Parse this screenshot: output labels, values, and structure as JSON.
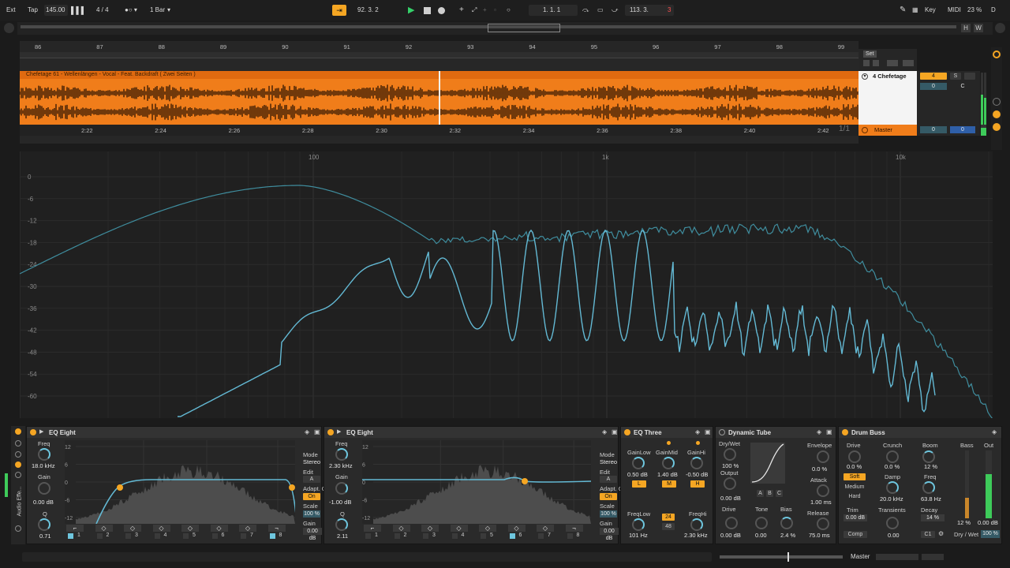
{
  "transport": {
    "ext": "Ext",
    "tap": "Tap",
    "tempo": "145.00",
    "signature": "4 / 4",
    "quantize": "1 Bar",
    "position": "92.  3.  2",
    "loop_start": "1.  1.  1",
    "loop_length": "113.  3.",
    "loop_length_accent": "3",
    "key": "Key",
    "midi": "MIDI",
    "cpu": "23 %",
    "d": "D"
  },
  "overview": {
    "h": "H",
    "w": "W"
  },
  "arrangement": {
    "bars": [
      "86",
      "87",
      "88",
      "89",
      "90",
      "91",
      "92",
      "93",
      "94",
      "95",
      "96",
      "97",
      "98",
      "99"
    ],
    "times": [
      "2:22",
      "2:24",
      "2:26",
      "2:28",
      "2:30",
      "2:32",
      "2:34",
      "2:36",
      "2:38",
      "2:40",
      "2:42"
    ],
    "clip_title": "Chefetage 61 - Wellenlängen  - Vocal        - Feat. Backdraft ( Zwei Seiten )",
    "set_label": "Set",
    "track_name": "4 Chefetage",
    "track_number": "4",
    "track_s": "S",
    "track_zero": "0",
    "track_c": "C",
    "master_label": "Master",
    "master_zero1": "0",
    "master_zero2": "0",
    "fraction": "1/1"
  },
  "spectrum": {
    "freq_labels": [
      "100",
      "1k",
      "10k"
    ],
    "db_labels": [
      "0",
      "-6",
      "-12",
      "-18",
      "-24",
      "-30",
      "-36",
      "-42",
      "-48",
      "-54",
      "-60"
    ],
    "line_color": "#63b9d4",
    "dim_line_color": "#3f8d9e"
  },
  "eq1": {
    "title": "EQ Eight",
    "freq_label": "Freq",
    "freq_val": "18.0 kHz",
    "gain_label": "Gain",
    "gain_val": "0.00 dB",
    "q_label": "Q",
    "q_val": "0.71",
    "db_scale": [
      "12",
      "6",
      "0",
      "-6",
      "-12"
    ],
    "freq_scale": [
      "100",
      "1k",
      "10k"
    ],
    "mode_label": "Mode",
    "mode_val": "Stereo",
    "edit": "Edit",
    "edit_a": "A",
    "adapt_label": "Adapt. Q",
    "adapt_val": "On",
    "scale_label": "Scale",
    "scale_val": "100 %",
    "gain2_label": "Gain",
    "gain2_val": "0.00 dB",
    "bands": [
      "1",
      "2",
      "3",
      "4",
      "5",
      "6",
      "7",
      "8"
    ],
    "side_label": "Audio Effe..."
  },
  "eq2": {
    "title": "EQ Eight",
    "freq_label": "Freq",
    "freq_val": "2.30 kHz",
    "gain_label": "Gain",
    "gain_val": "-1.00 dB",
    "q_label": "Q",
    "q_val": "2.11",
    "db_scale": [
      "12",
      "6",
      "0",
      "-6",
      "-12"
    ],
    "freq_scale": [
      "100",
      "1k",
      "10k"
    ],
    "mode_label": "Mode",
    "mode_val": "Stereo",
    "edit": "Edit",
    "edit_a": "A",
    "adapt_label": "Adapt. Q",
    "adapt_val": "On",
    "scale_label": "Scale",
    "scale_val": "100 %",
    "gain2_label": "Gain",
    "gain2_val": "0.00 dB",
    "bands": [
      "1",
      "2",
      "3",
      "4",
      "5",
      "6",
      "7",
      "8"
    ]
  },
  "eq3": {
    "title": "EQ Three",
    "gainlow_label": "GainLow",
    "gainmid_label": "GainMid",
    "gainhi_label": "GainHi",
    "gainlow_val": "0.50 dB",
    "gainmid_val": "1.40 dB",
    "gainhi_val": "-0.50 dB",
    "l": "L",
    "m": "M",
    "h": "H",
    "freqlow_label": "FreqLow",
    "freqhi_label": "FreqHi",
    "freqlow_val": "101 Hz",
    "freqhi_val": "2.30 kHz",
    "slope_24": "24",
    "slope_48": "48"
  },
  "tube": {
    "title": "Dynamic Tube",
    "drywet_label": "Dry/Wet",
    "drywet_val": "100 %",
    "output_label": "Output",
    "output_val": "0.00 dB",
    "envelope_label": "Envelope",
    "envelope_val": "0.0 %",
    "attack_label": "Attack",
    "attack_val": "1.00 ms",
    "release_label": "Release",
    "release_val": "75.0 ms",
    "drive_label": "Drive",
    "tone_label": "Tone",
    "bias_label": "Bias",
    "drive_val": "0.00 dB",
    "tone_val": "0.00",
    "bias_val": "2.4 %",
    "abc": [
      "A",
      "B",
      "C"
    ]
  },
  "drumbuss": {
    "title": "Drum Buss",
    "drive_label": "Drive",
    "drive_val": "0.0 %",
    "crunch_label": "Crunch",
    "crunch_val": "0.0 %",
    "boom_label": "Boom",
    "boom_val": "12 %",
    "soft": "Soft",
    "medium": "Medium",
    "hard": "Hard",
    "damp_label": "Damp",
    "damp_val": "20.0 kHz",
    "freq_label": "Freq",
    "freq_val": "63.8 Hz",
    "trim_label": "Trim",
    "trim_val": "0.00 dB",
    "transients_label": "Transients",
    "transients_val": "0.00",
    "decay_label": "Decay",
    "decay_val": "14 %",
    "comp": "Comp",
    "bass_label": "Bass",
    "out_label": "Out",
    "bass_val": "12 %",
    "out_val": "0.00 dB",
    "drywet_label": "Dry / Wet",
    "drywet_val": "100 %",
    "c1": "C1"
  },
  "bottom": {
    "master": "Master"
  }
}
